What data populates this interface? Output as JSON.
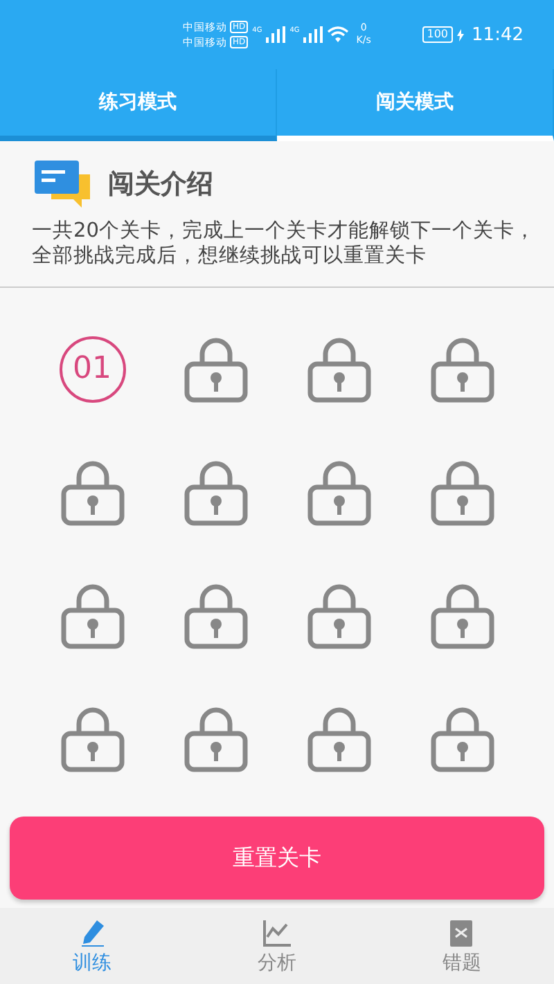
{
  "status_bar": {
    "carriers": [
      "中国移动",
      "中国移动"
    ],
    "hd_badge": [
      "HD",
      "HD"
    ],
    "network_types": [
      "4G",
      "4G"
    ],
    "speed_value": "0",
    "speed_unit": "K/s",
    "battery": "100",
    "time": "11:42"
  },
  "tabs": [
    {
      "label": "练习模式",
      "selected": false
    },
    {
      "label": "闯关模式",
      "selected": true
    }
  ],
  "intro": {
    "title": "闯关介绍",
    "text": "一共20个关卡，完成上一个关卡才能解锁下一个关卡，全部挑战完成后，想继续挑战可以重置关卡"
  },
  "levels": [
    {
      "kind": "unlocked",
      "label": "01"
    },
    {
      "kind": "locked"
    },
    {
      "kind": "locked"
    },
    {
      "kind": "locked"
    },
    {
      "kind": "locked"
    },
    {
      "kind": "locked"
    },
    {
      "kind": "locked"
    },
    {
      "kind": "locked"
    },
    {
      "kind": "locked"
    },
    {
      "kind": "locked"
    },
    {
      "kind": "locked"
    },
    {
      "kind": "locked"
    },
    {
      "kind": "locked"
    },
    {
      "kind": "locked"
    },
    {
      "kind": "locked"
    },
    {
      "kind": "locked"
    }
  ],
  "reset_button": "重置关卡",
  "bottom_nav": [
    {
      "kind": "pen",
      "label": "训练",
      "selected": true
    },
    {
      "kind": "chart",
      "label": "分析",
      "selected": false
    },
    {
      "kind": "document",
      "label": "错题",
      "selected": false
    }
  ]
}
